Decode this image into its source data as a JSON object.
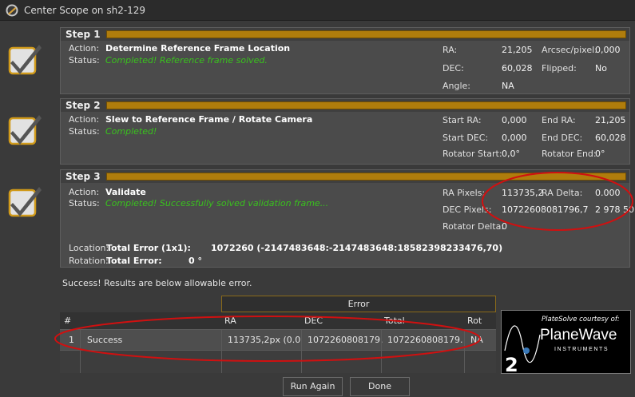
{
  "window": {
    "title": "Center Scope on sh2-129"
  },
  "steps": [
    {
      "label": "Step 1",
      "action_key": "Action:",
      "action": "Determine Reference Frame Location",
      "status_key": "Status:",
      "status": "Completed!  Reference frame solved.",
      "fields": {
        "ra_k": "RA:",
        "ra_v": "21,205",
        "arcsec_k": "Arcsec/pixel:",
        "arcsec_v": "0,000",
        "dec_k": "DEC:",
        "dec_v": "60,028",
        "flipped_k": "Flipped:",
        "flipped_v": "No",
        "angle_k": "Angle:",
        "angle_v": "NA"
      }
    },
    {
      "label": "Step 2",
      "action_key": "Action:",
      "action": "Slew to Reference Frame / Rotate Camera",
      "status_key": "Status:",
      "status": "Completed!",
      "fields": {
        "start_ra_k": "Start RA:",
        "start_ra_v": "0,000",
        "end_ra_k": "End RA:",
        "end_ra_v": "21,205",
        "start_dec_k": "Start DEC:",
        "start_dec_v": "0,000",
        "end_dec_k": "End DEC:",
        "end_dec_v": "60,028",
        "rot_start_k": "Rotator Start:",
        "rot_start_v": "0,0°",
        "rot_end_k": "Rotator End:",
        "rot_end_v": "0°"
      }
    },
    {
      "label": "Step 3",
      "action_key": "Action:",
      "action": "Validate",
      "status_key": "Status:",
      "status": "Completed!  Successfully solved validation frame...",
      "fields": {
        "ra_px_k": "RA Pixels:",
        "ra_px_v": "113735,2",
        "ra_delta_k": "RA Delta:",
        "ra_delta_v": "0.000",
        "dec_px_k": "DEC Pixels:",
        "dec_px_v": "10722608081796,7",
        "dec_delta_v": "2 978 50",
        "rot_delta_k": "Rotator Delta:",
        "rot_delta_v": "0"
      },
      "location_k": "Location:",
      "location_lbl": "Total Error (1x1):",
      "location_v": "1072260 (-2147483648:-2147483648:18582398233476,70)",
      "rotation_k": "Rotation:",
      "rotation_lbl": "Total Error:",
      "rotation_v": "0 °"
    }
  ],
  "message": "Success! Results are below allowable error.",
  "grid": {
    "error_header": "Error",
    "columns": {
      "num": "#",
      "ra": "RA",
      "dec": "DEC",
      "total": "Total",
      "rot": "Rot"
    },
    "rows": [
      {
        "num": "1",
        "result": "Success",
        "ra": "113735,2px (0.0...",
        "dec": "1072260808179...",
        "total": "1072260808179...",
        "rot": "NA"
      }
    ]
  },
  "logo": {
    "courtesy": "PlateSolve courtesy of:",
    "brand": "PlaneWave",
    "sub": "INSTRUMENTS",
    "digit": "2"
  },
  "buttons": {
    "run_again": "Run Again",
    "done": "Done"
  }
}
